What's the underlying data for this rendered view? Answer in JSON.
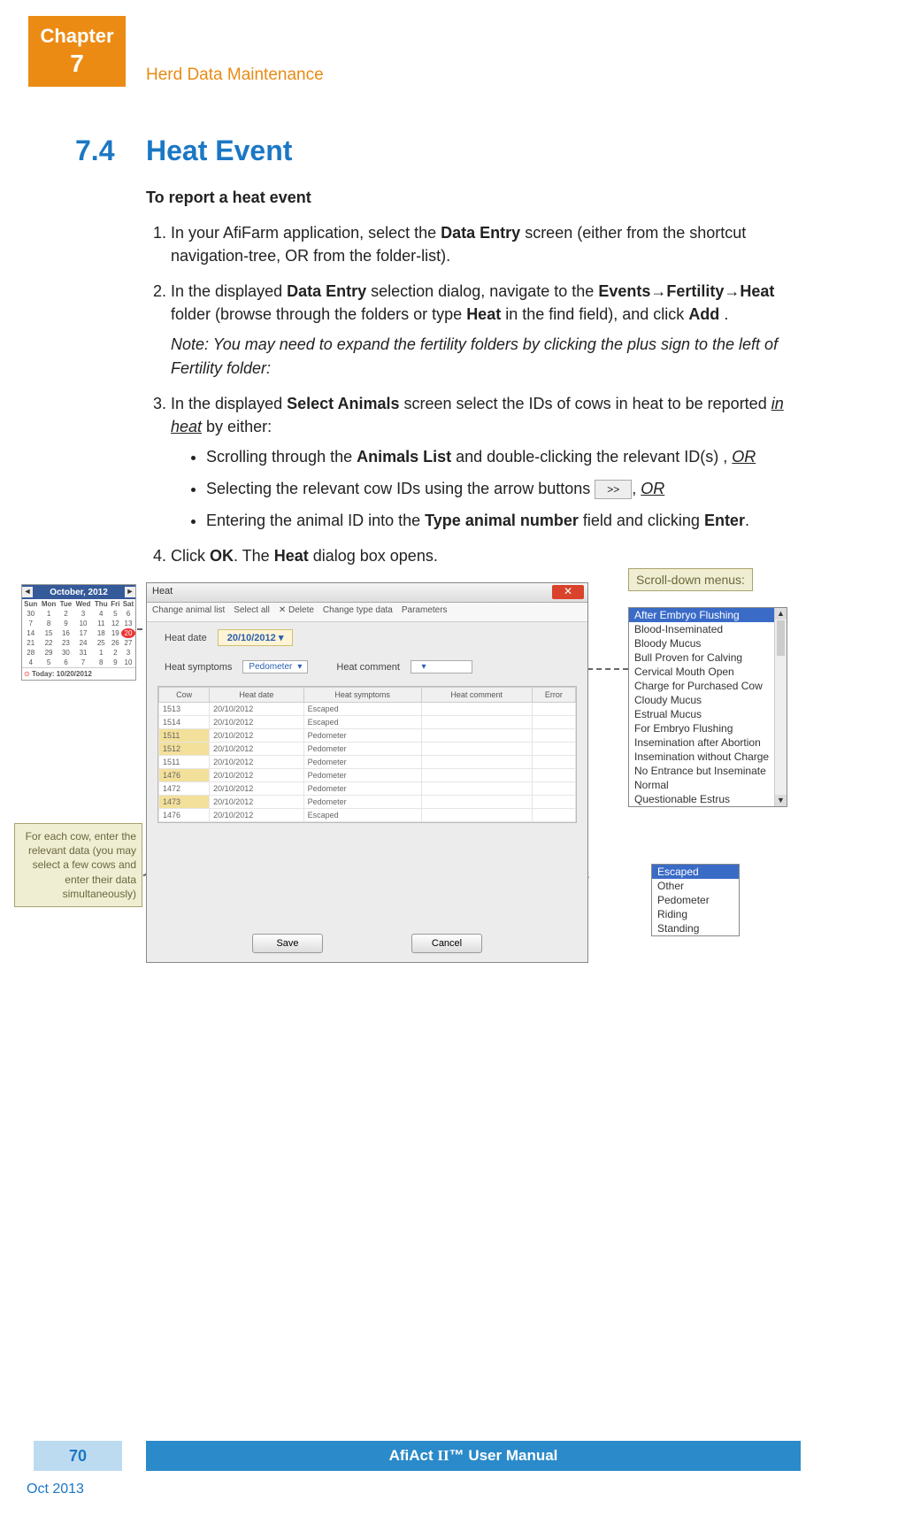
{
  "chapter": {
    "label": "Chapter",
    "num": "7",
    "header": "Herd Data Maintenance"
  },
  "section": {
    "num": "7.4",
    "title": "Heat Event",
    "subhead": "To report a heat event"
  },
  "steps": {
    "s1_a": "In your AfiFarm application, select the ",
    "s1_b": "Data Entry",
    "s1_c": " screen (either from the shortcut navigation-tree, OR from the folder-list).",
    "s2_a": "In the displayed ",
    "s2_b": "Data Entry",
    "s2_c": " selection dialog, navigate to the ",
    "s2_d": "Events→Fertility→Heat",
    "s2_e": " folder (browse through the folders or type ",
    "s2_f": "Heat",
    "s2_g": " in the find field), and click ",
    "s2_h": "Add",
    "s2_i": " .",
    "s2_note": "Note: You may need to expand the fertility folders by clicking the plus sign to the left of Fertility folder:",
    "s3_a": "In the displayed ",
    "s3_b": "Select Animals",
    "s3_c": " screen select the IDs of cows in heat to be reported ",
    "s3_d": "in heat",
    "s3_e": " by either:",
    "b1_a": "Scrolling through the ",
    "b1_b": "Animals List",
    "b1_c": " and double-clicking the relevant ID(s) , ",
    "b1_d": "OR",
    "b2_a": "Selecting the relevant cow IDs using the arrow buttons ",
    "b2_btn": ">>",
    "b2_b": ", ",
    "b2_c": "OR",
    "b3_a": "Entering the animal ID into the ",
    "b3_b": "Type animal number",
    "b3_c": " field and clicking ",
    "b3_d": "Enter",
    "b3_e": ".",
    "s4_a": "Click ",
    "s4_b": "OK",
    "s4_c": ". The ",
    "s4_d": "Heat",
    "s4_e": " dialog box opens."
  },
  "calendar": {
    "month": "October, 2012",
    "days": [
      "Sun",
      "Mon",
      "Tue",
      "Wed",
      "Thu",
      "Fri",
      "Sat"
    ],
    "weeks": [
      [
        "30",
        "1",
        "2",
        "3",
        "4",
        "5",
        "6"
      ],
      [
        "7",
        "8",
        "9",
        "10",
        "11",
        "12",
        "13"
      ],
      [
        "14",
        "15",
        "16",
        "17",
        "18",
        "19",
        "20"
      ],
      [
        "21",
        "22",
        "23",
        "24",
        "25",
        "26",
        "27"
      ],
      [
        "28",
        "29",
        "30",
        "31",
        "1",
        "2",
        "3"
      ],
      [
        "4",
        "5",
        "6",
        "7",
        "8",
        "9",
        "10"
      ]
    ],
    "today_cell": "20",
    "footer": "Today: 10/20/2012"
  },
  "cow_note": "For each cow, enter the relevant data (you may select a few cows and enter their data simultaneously)",
  "dialog": {
    "title": "Heat",
    "toolbar": [
      "Change animal list",
      "Select all",
      "✕ Delete",
      "Change type data",
      "Parameters"
    ],
    "heat_date_label": "Heat date",
    "heat_date_value": "20/10/2012",
    "heat_symptoms_label": "Heat symptoms",
    "heat_symptoms_value": "Pedometer",
    "heat_comment_label": "Heat comment",
    "grid_headers": [
      "Cow",
      "Heat date",
      "Heat symptoms",
      "Heat comment",
      "Error"
    ],
    "rows": [
      {
        "cow": "1513",
        "date": "20/10/2012",
        "sym": "Escaped",
        "sel": false
      },
      {
        "cow": "1514",
        "date": "20/10/2012",
        "sym": "Escaped",
        "sel": false
      },
      {
        "cow": "1511",
        "date": "20/10/2012",
        "sym": "Pedometer",
        "sel": true
      },
      {
        "cow": "1512",
        "date": "20/10/2012",
        "sym": "Pedometer",
        "sel": true
      },
      {
        "cow": "1511",
        "date": "20/10/2012",
        "sym": "Pedometer",
        "sel": false
      },
      {
        "cow": "1476",
        "date": "20/10/2012",
        "sym": "Pedometer",
        "sel": true
      },
      {
        "cow": "1472",
        "date": "20/10/2012",
        "sym": "Pedometer",
        "sel": false
      },
      {
        "cow": "1473",
        "date": "20/10/2012",
        "sym": "Pedometer",
        "sel": true
      },
      {
        "cow": "1476",
        "date": "20/10/2012",
        "sym": "Escaped",
        "sel": false
      }
    ],
    "save": "Save",
    "cancel": "Cancel"
  },
  "sd_label": "Scroll-down menus:",
  "listbox1": [
    "After Embryo Flushing",
    "Blood-Inseminated",
    "Bloody Mucus",
    "Bull Proven for Calving",
    "Cervical Mouth Open",
    "Charge for Purchased Cow",
    "Cloudy Mucus",
    "Estrual Mucus",
    "For Embryo Flushing",
    "Insemination after Abortion",
    "Insemination without Charge",
    "No Entrance but Inseminate",
    "Normal",
    "Questionable Estrus"
  ],
  "listbox2": [
    "Escaped",
    "Other",
    "Pedometer",
    "Riding",
    "Standing"
  ],
  "footer": {
    "page": "70",
    "title_a": "AfiAct ",
    "title_b": "II",
    "title_c": "™ User Manual",
    "date": "Oct 2013"
  }
}
